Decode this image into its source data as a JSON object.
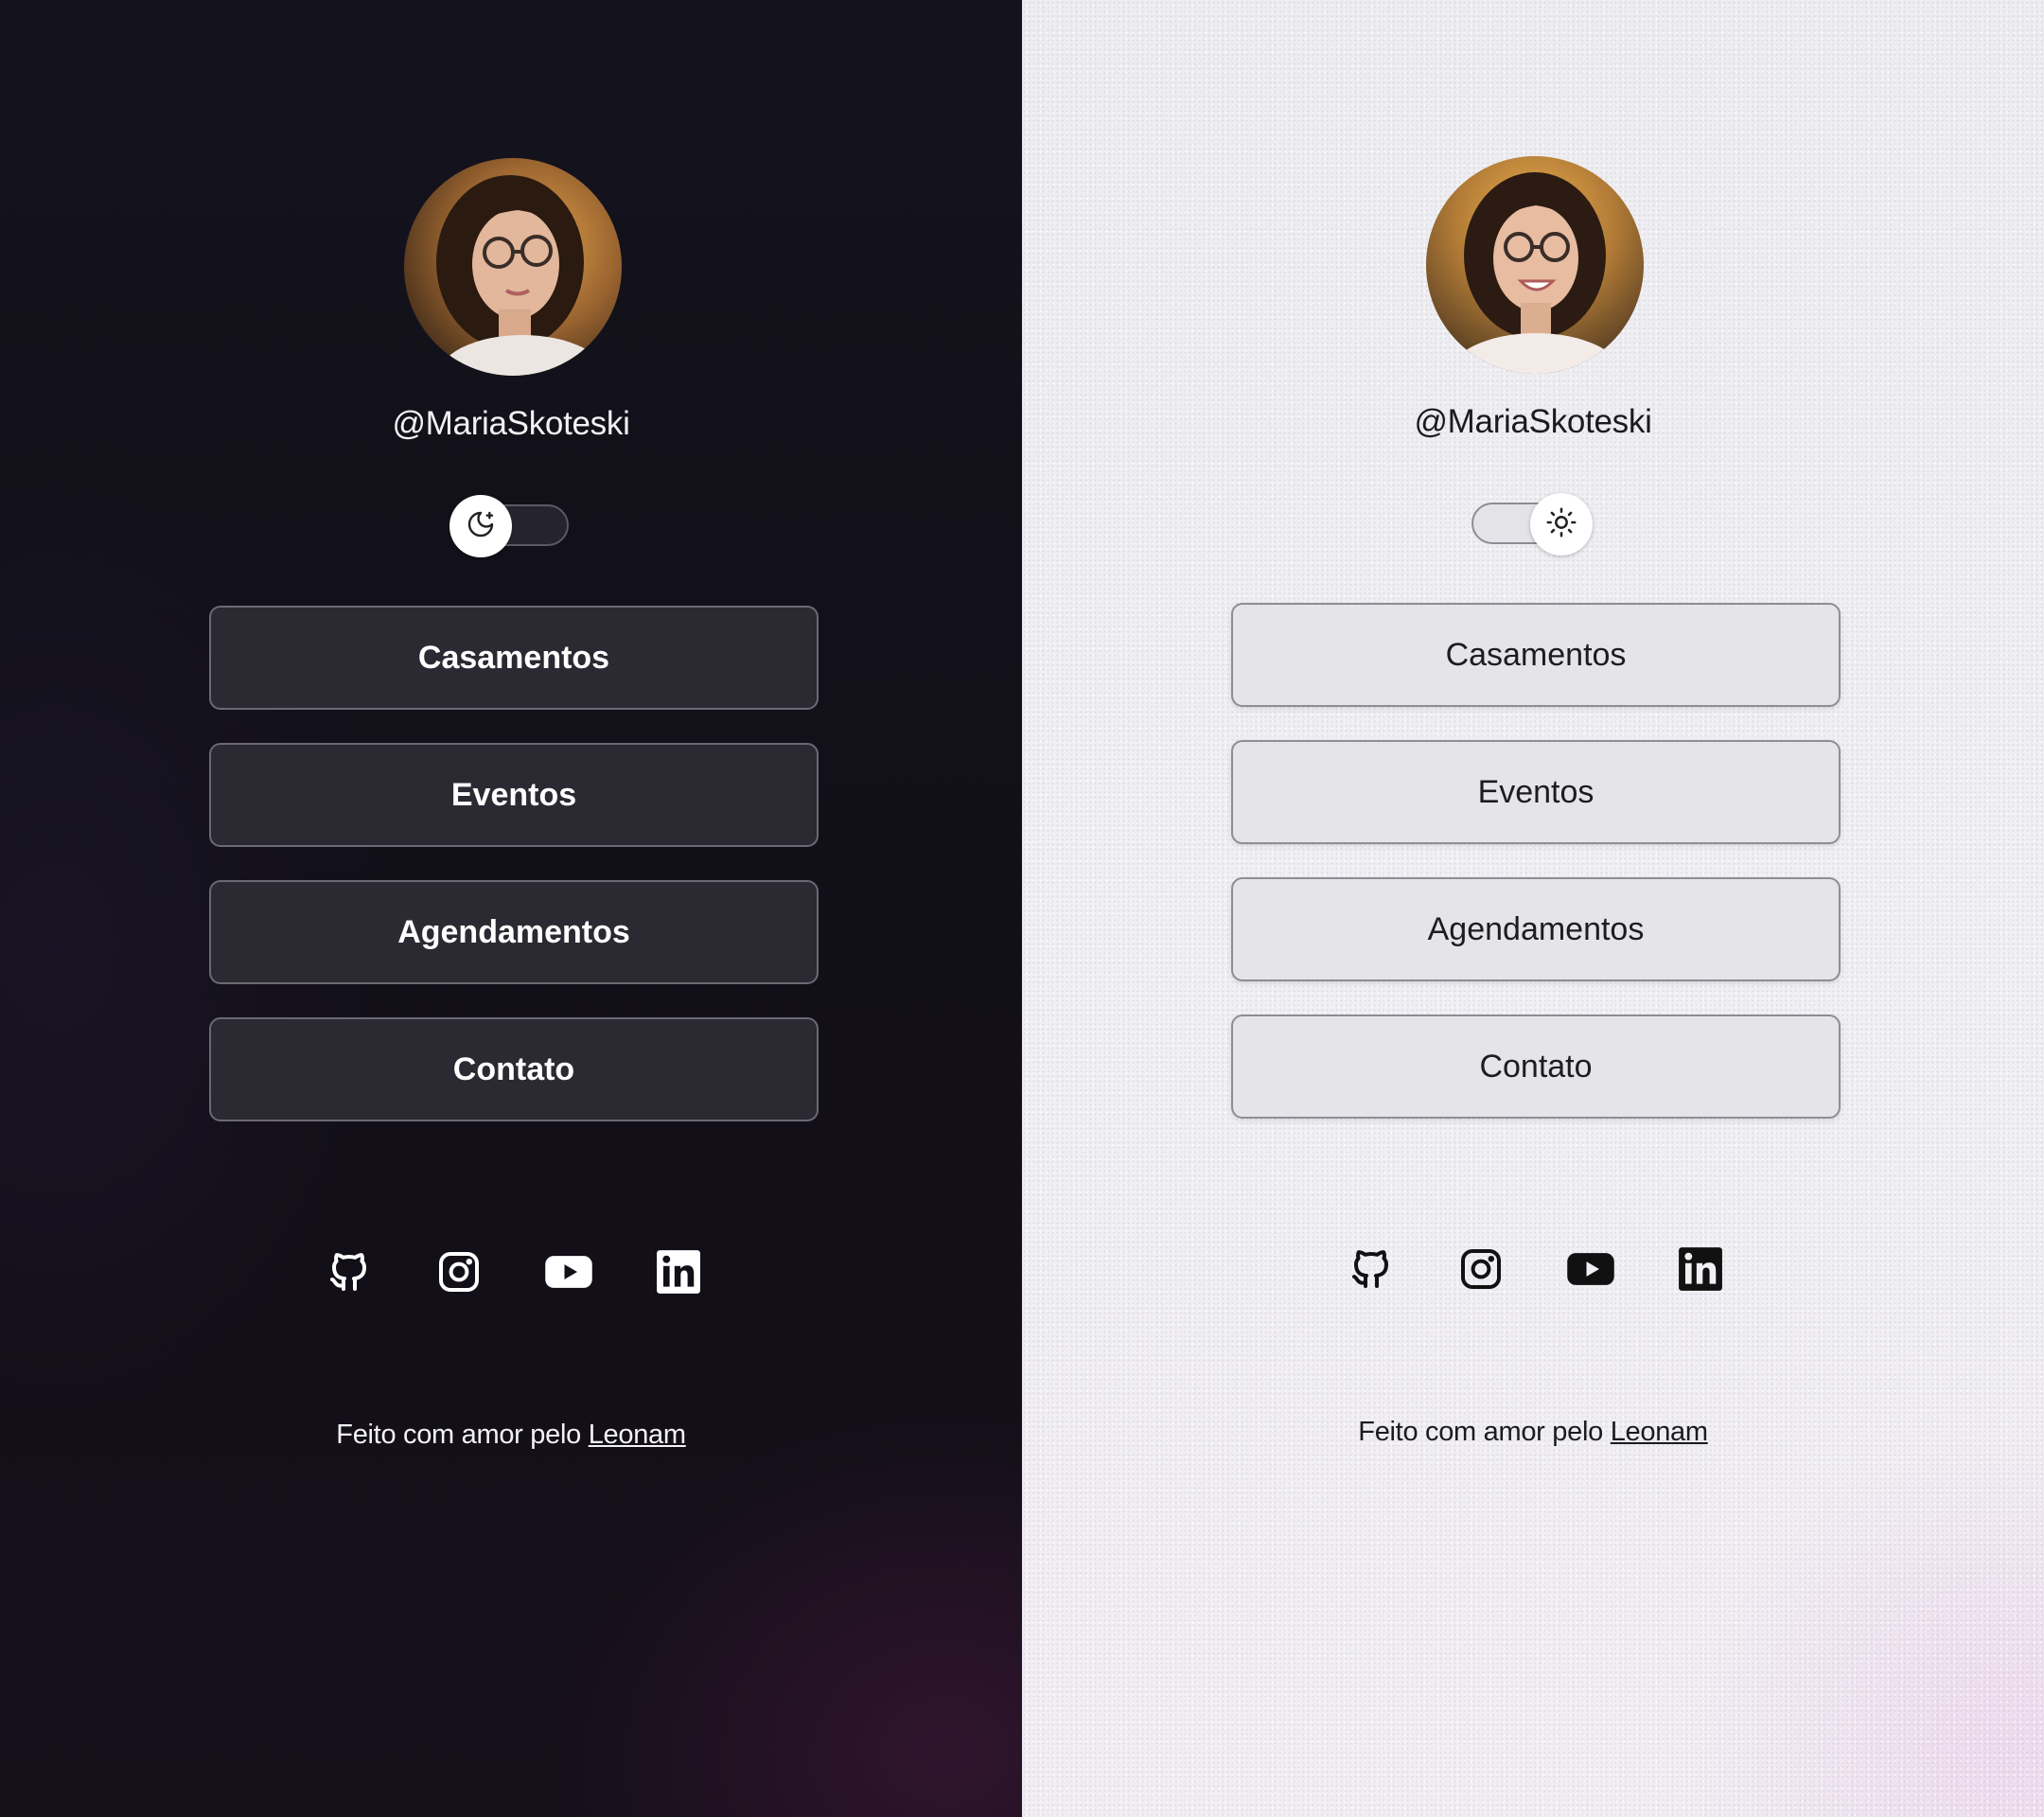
{
  "dark": {
    "handle": "@MariaSkoteski",
    "theme_toggle": {
      "mode": "dark",
      "icon": "moon-icon"
    },
    "buttons": [
      "Casamentos",
      "Eventos",
      "Agendamentos",
      "Contato"
    ],
    "socials": [
      "github-icon",
      "instagram-icon",
      "youtube-icon",
      "linkedin-icon"
    ],
    "footer": {
      "text": "Feito com amor pelo",
      "link": "Leonam"
    },
    "colors": {
      "background": "#13121b",
      "button_bg": "#2b2a32",
      "button_border": "#6b6a74",
      "text": "#ffffff"
    }
  },
  "light": {
    "handle": "@MariaSkoteski",
    "theme_toggle": {
      "mode": "light",
      "icon": "sun-icon"
    },
    "buttons": [
      "Casamentos",
      "Eventos",
      "Agendamentos",
      "Contato"
    ],
    "socials": [
      "github-icon",
      "instagram-icon",
      "youtube-icon",
      "linkedin-icon"
    ],
    "footer": {
      "text": "Feito com amor pelo",
      "link": "Leonam"
    },
    "colors": {
      "background": "#efeef2",
      "button_bg": "#e5e4e8",
      "button_border": "#8e8d96",
      "text": "#1d1d21"
    }
  }
}
